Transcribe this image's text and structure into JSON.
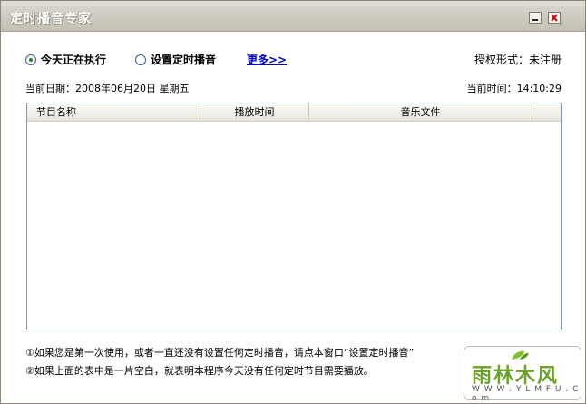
{
  "window": {
    "title": "定时播音专家"
  },
  "radios": {
    "today_label": "今天正在执行",
    "schedule_label": "设置定时播音"
  },
  "more_link": "更多>>",
  "auth": {
    "text": "授权形式：未注册"
  },
  "date_line": "当前日期：2008年06月20日  星期五",
  "time_line": "当前时间：14:10:29",
  "table": {
    "columns": [
      "节目名称",
      "播放时间",
      "音乐文件",
      ""
    ],
    "rows": []
  },
  "notes": {
    "note1": "①如果您是第一次使用，或者一直还没有设置任何定时播音，请点本窗口“设置定时播音”",
    "note2": "②如果上面的表中是一片空白，就表明本程序今天没有任何定时节目需要播放。"
  },
  "watermark": {
    "text": "雨林木风",
    "sub": "W W W . Y L M F U . C o m"
  },
  "colors": {
    "title_bar": "#cfcdc2",
    "link": "#0000cc",
    "radio_dot": "#2e7d32",
    "watermark_green": "#6aa22a"
  },
  "icons": {
    "minimize": "minimize-icon",
    "close": "close-icon",
    "leaf": "leaf-icon"
  }
}
